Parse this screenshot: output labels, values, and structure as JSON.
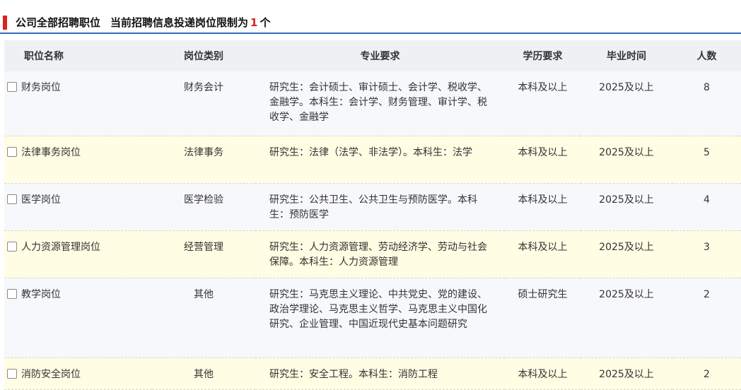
{
  "header": {
    "title": "公司全部招聘职位",
    "limit_prefix": "当前招聘信息投递岗位限制为",
    "limit_num": "1",
    "limit_suffix": "个"
  },
  "table": {
    "columns": [
      "职位名称",
      "岗位类别",
      "专业要求",
      "学历要求",
      "毕业时间",
      "人数"
    ],
    "rows": [
      {
        "name": "财务岗位",
        "category": "财务会计",
        "major": "研究生：会计硕士、审计硕士、会计学、税收学、金融学。本科生：会计学、财务管理、审计学、税收学、金融学",
        "education": "本科及以上",
        "grad": "2025及以上",
        "count": "8"
      },
      {
        "name": "法律事务岗位",
        "category": "法律事务",
        "major": "研究生：法律（法学、非法学）。本科生：法学",
        "education": "本科及以上",
        "grad": "2025及以上",
        "count": "5"
      },
      {
        "name": "医学岗位",
        "category": "医学检验",
        "major": "研究生：公共卫生、公共卫生与预防医学。本科生：预防医学",
        "education": "本科及以上",
        "grad": "2025及以上",
        "count": "4"
      },
      {
        "name": "人力资源管理岗位",
        "category": "经营管理",
        "major": "研究生：人力资源管理、劳动经济学、劳动与社会保障。本科生：人力资源管理",
        "education": "本科及以上",
        "grad": "2025及以上",
        "count": "3"
      },
      {
        "name": "教学岗位",
        "category": "其他",
        "major": "研究生：马克思主义理论、中共党史、党的建设、政治学理论、马克思主义哲学、马克思主义中国化研究、企业管理、中国近现代史基本问题研究",
        "education": "硕士研究生",
        "grad": "2025及以上",
        "count": "2"
      },
      {
        "name": "消防安全岗位",
        "category": "其他",
        "major": "研究生：安全工程。本科生：消防工程",
        "education": "本科及以上",
        "grad": "2025及以上",
        "count": "2"
      }
    ]
  }
}
